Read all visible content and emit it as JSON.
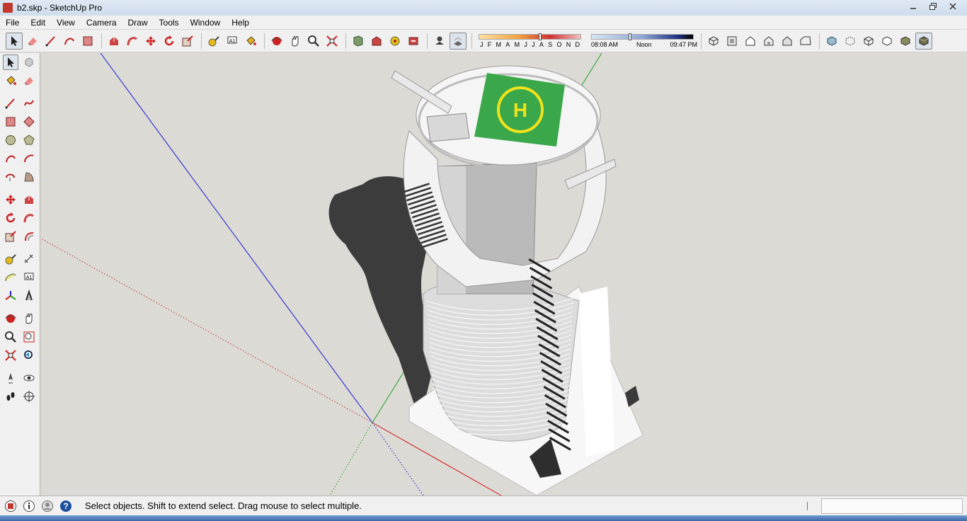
{
  "window": {
    "title": "b2.skp - SketchUp Pro",
    "controls": [
      "minimize",
      "restore",
      "close"
    ]
  },
  "menu": {
    "items": [
      "File",
      "Edit",
      "View",
      "Camera",
      "Draw",
      "Tools",
      "Window",
      "Help"
    ]
  },
  "toolbar": {
    "groups": [
      [
        "select-tool",
        "eraser-tool",
        "line-tool",
        "arc-tool",
        "rectangle-tool"
      ],
      [
        "push-pull-tool",
        "follow-me-tool",
        "move-tool",
        "rotate-tool",
        "scale-tool"
      ],
      [
        "tape-measure-tool",
        "text-tool",
        "paint-bucket-tool"
      ],
      [
        "orbit-tool",
        "pan-tool",
        "zoom-tool",
        "zoom-extents-tool"
      ],
      [
        "components-tool",
        "warehouse-tool",
        "extension-tool",
        "share-tool"
      ],
      [
        "shadow-toggle",
        "fog-toggle"
      ]
    ],
    "shadow_months": [
      "J",
      "F",
      "M",
      "A",
      "M",
      "J",
      "J",
      "A",
      "S",
      "O",
      "N",
      "D"
    ],
    "time_start": "08:08 AM",
    "time_mid": "Noon",
    "time_end": "09:47 PM",
    "views": [
      "iso-view",
      "top-view",
      "front-view",
      "right-view",
      "back-view",
      "left-view"
    ],
    "styles": [
      "xray-style",
      "back-edges-style",
      "wireframe-style",
      "hidden-line-style",
      "shaded-style",
      "textured-style"
    ]
  },
  "left_toolbar": {
    "rows": [
      [
        "select-tool",
        "make-component-tool"
      ],
      [
        "paint-bucket-tool",
        "eraser-tool"
      ],
      [
        "line-tool",
        "freehand-tool"
      ],
      [
        "rectangle-tool",
        "rotated-rectangle-tool"
      ],
      [
        "circle-tool",
        "polygon-tool"
      ],
      [
        "arc-tool",
        "two-point-arc-tool"
      ],
      [
        "three-point-arc-tool",
        "pie-tool"
      ],
      [
        "move-tool",
        "push-pull-tool"
      ],
      [
        "rotate-tool",
        "follow-me-tool"
      ],
      [
        "scale-tool",
        "offset-tool"
      ],
      [
        "tape-measure-tool",
        "dimension-tool"
      ],
      [
        "protractor-tool",
        "text-tool"
      ],
      [
        "axes-tool",
        "3d-text-tool"
      ],
      [
        "orbit-tool",
        "pan-tool"
      ],
      [
        "zoom-tool",
        "zoom-window-tool"
      ],
      [
        "zoom-extents-tool",
        "previous-view-tool"
      ],
      [
        "position-camera-tool",
        "look-around-tool"
      ],
      [
        "walk-tool",
        "section-plane-tool"
      ]
    ]
  },
  "viewport": {
    "model": "helipad-tower",
    "helipad_letter": "H",
    "colors": {
      "background": "#dcdad5",
      "helipad": "#3aa84a",
      "helipad_ring": "#f2e21a",
      "shadow": "#3c3c3c"
    }
  },
  "status": {
    "text": "Select objects. Shift to extend select. Drag mouse to select multiple.",
    "measurements_value": ""
  }
}
